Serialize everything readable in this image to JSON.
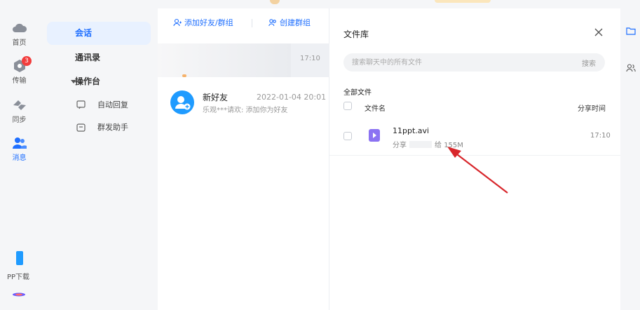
{
  "rail": {
    "items": [
      {
        "label": "首页",
        "icon": "cloud-icon"
      },
      {
        "label": "传输",
        "icon": "transfer-icon",
        "badge": "3"
      },
      {
        "label": "同步",
        "icon": "sync-icon"
      },
      {
        "label": "消息",
        "icon": "message-icon",
        "active": true
      }
    ],
    "app_download": "PP下载"
  },
  "nav": {
    "items": [
      "会话",
      "通讯录",
      "操作台"
    ],
    "sub_items": [
      "自动回复",
      "群发助手"
    ]
  },
  "conversations": {
    "add_friend": "添加好友/群组",
    "create_group": "创建群组",
    "row1_time": "17:10",
    "row2": {
      "name": "新好友",
      "time": "2022-01-04 20:01",
      "preview": "乐观***请欢: 添加你为好友"
    }
  },
  "file_library": {
    "title": "文件库",
    "search_placeholder": "搜索聊天中的所有文件",
    "search_button": "搜索",
    "section": "全部文件",
    "columns": {
      "name": "文件名",
      "time": "分享时间"
    },
    "file": {
      "name": "11ppt.avi",
      "share_label": "分享",
      "size_prefix": "给",
      "size": "155M",
      "time": "17:10"
    }
  },
  "colors": {
    "accent": "#1f6fff",
    "badge": "#f23d3d",
    "arrow": "#d8262b"
  }
}
